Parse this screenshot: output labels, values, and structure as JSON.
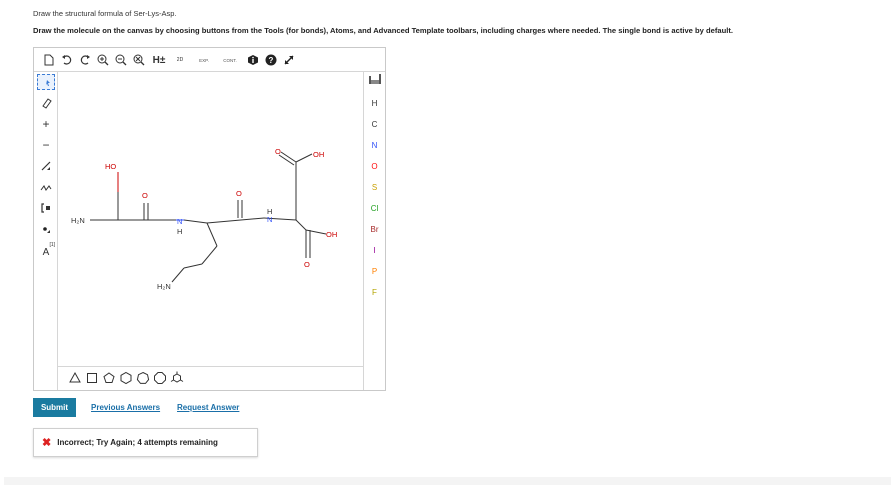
{
  "question": {
    "prompt": "Draw the structural formula of Ser-Lys-Asp.",
    "instructions": "Draw the molecule on the canvas by choosing buttons from the Tools (for bonds), Atoms, and Advanced Template toolbars, including charges where needed. The single bond is active by default."
  },
  "top_toolbar": {
    "items": [
      "new-document-icon",
      "undo-icon",
      "redo-icon",
      "zoom-in-icon",
      "zoom-out-icon",
      "zoom-reset-icon",
      "add-hydrogens-icon",
      "2d-clean-icon",
      "expand-icon",
      "contract-icon",
      "info-icon",
      "help-icon",
      "fullscreen-icon"
    ],
    "labels": {
      "h": "H±",
      "d2": "2D",
      "exp": "EXP.",
      "cont": "CONT."
    }
  },
  "left_toolbar": {
    "items": [
      "selection-tool-icon",
      "eraser-icon",
      "positive-charge-icon",
      "negative-charge-icon",
      "single-bond-icon",
      "chain-icon",
      "bracket-icon",
      "radical-icon",
      "atom-label-icon"
    ],
    "labels": {
      "plus": "+",
      "minus": "−",
      "bracket": "[1]",
      "atom_a": "A"
    }
  },
  "right_toolbar": {
    "atoms": [
      {
        "symbol": "H",
        "color": "#333333"
      },
      {
        "symbol": "C",
        "color": "#333333"
      },
      {
        "symbol": "N",
        "color": "#3050f8"
      },
      {
        "symbol": "O",
        "color": "#ff0d0d"
      },
      {
        "symbol": "S",
        "color": "#c8a000"
      },
      {
        "symbol": "Cl",
        "color": "#1f9e1f"
      },
      {
        "symbol": "Br",
        "color": "#a62929"
      },
      {
        "symbol": "I",
        "color": "#940094"
      },
      {
        "symbol": "P",
        "color": "#ff8000"
      },
      {
        "symbol": "F",
        "color": "#b3a400"
      }
    ]
  },
  "bottom_toolbar": {
    "shapes": [
      "cyclopropane-icon",
      "cyclobutane-icon",
      "cyclopentane-icon",
      "cyclohexane-icon",
      "cycloheptane-icon",
      "cyclooctane-icon",
      "benzene-template-icon"
    ]
  },
  "molecule_labels": {
    "ho_left": "HO",
    "h2n_left": "H₂N",
    "nh_1": "N",
    "h_1": "H",
    "nh_2": "N",
    "h_2": "H",
    "o_1": "O",
    "o_2": "O",
    "o_top": "O",
    "oh_top": "OH",
    "oh_right": "OH",
    "o_bottom": "O",
    "h2n_bottom": "H₂N"
  },
  "actions": {
    "submit": "Submit",
    "previous_answers": "Previous Answers",
    "request_answer": "Request Answer"
  },
  "feedback": {
    "message": "Incorrect; Try Again; 4 attempts remaining",
    "status_color": "#dd2222"
  }
}
